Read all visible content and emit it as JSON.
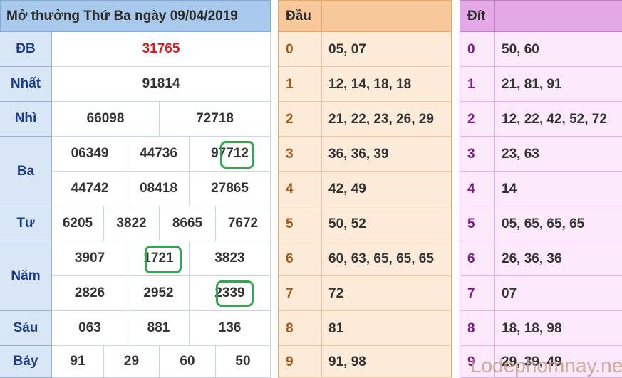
{
  "results": {
    "title": "Mở thưởng Thứ Ba ngày 09/04/2019",
    "colors": {
      "header": "#a8c8ec",
      "label": "#1a3c8c",
      "special": "#e0151c",
      "highlight": "#2fa84f"
    },
    "rows": [
      {
        "label": "ĐB",
        "values": [
          "31765"
        ]
      },
      {
        "label": "Nhất",
        "values": [
          "91814"
        ]
      },
      {
        "label": "Nhì",
        "values": [
          "66098",
          "72718"
        ]
      },
      {
        "label": "Ba",
        "values": [
          "06349",
          "44736",
          "97712",
          "44742",
          "08418",
          "27865"
        ]
      },
      {
        "label": "Tư",
        "values": [
          "6205",
          "3822",
          "8665",
          "7672"
        ]
      },
      {
        "label": "Năm",
        "values": [
          "3907",
          "1721",
          "3823",
          "2826",
          "2952",
          "2339"
        ]
      },
      {
        "label": "Sáu",
        "values": [
          "063",
          "881",
          "136"
        ]
      },
      {
        "label": "Bảy",
        "values": [
          "91",
          "29",
          "60",
          "50"
        ]
      }
    ]
  },
  "dau": {
    "header": "Đầu",
    "rows": [
      {
        "k": "0",
        "v": "05, 07"
      },
      {
        "k": "1",
        "v": "12, 14, 18, 18"
      },
      {
        "k": "2",
        "v": "21, 22, 23, 26, 29"
      },
      {
        "k": "3",
        "v": "36, 36, 39"
      },
      {
        "k": "4",
        "v": "42, 49"
      },
      {
        "k": "5",
        "v": "50, 52"
      },
      {
        "k": "6",
        "v": "60, 63, 65, 65, 65"
      },
      {
        "k": "7",
        "v": "72"
      },
      {
        "k": "8",
        "v": "81"
      },
      {
        "k": "9",
        "v": "91, 98"
      }
    ]
  },
  "dit": {
    "header": "Đít",
    "rows": [
      {
        "k": "0",
        "v": "50, 60"
      },
      {
        "k": "1",
        "v": "21, 81, 91"
      },
      {
        "k": "2",
        "v": "12, 22, 42, 52, 72"
      },
      {
        "k": "3",
        "v": "23, 63"
      },
      {
        "k": "4",
        "v": "14"
      },
      {
        "k": "5",
        "v": "05, 65, 65, 65"
      },
      {
        "k": "6",
        "v": "26, 36, 36"
      },
      {
        "k": "7",
        "v": "07"
      },
      {
        "k": "8",
        "v": "18, 18, 98"
      },
      {
        "k": "9",
        "v": "29, 39, 49"
      }
    ]
  },
  "watermark": "Lodephomnay.net"
}
